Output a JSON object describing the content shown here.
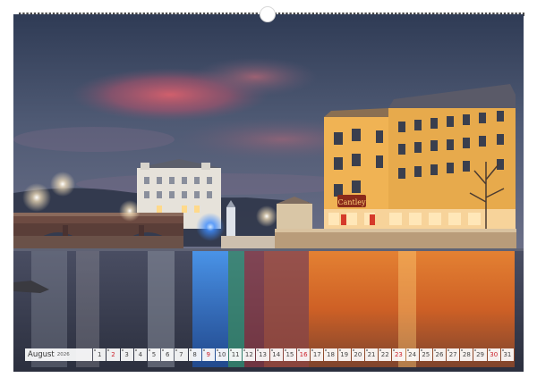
{
  "calendar": {
    "month": "August",
    "year": "2026",
    "days": [
      {
        "n": "1",
        "red": false
      },
      {
        "n": "2",
        "red": true
      },
      {
        "n": "3",
        "red": false
      },
      {
        "n": "4",
        "red": false
      },
      {
        "n": "5",
        "red": false
      },
      {
        "n": "6",
        "red": false
      },
      {
        "n": "7",
        "red": false
      },
      {
        "n": "8",
        "red": false
      },
      {
        "n": "9",
        "red": true
      },
      {
        "n": "10",
        "red": false
      },
      {
        "n": "11",
        "red": false
      },
      {
        "n": "12",
        "red": false
      },
      {
        "n": "13",
        "red": false
      },
      {
        "n": "14",
        "red": false
      },
      {
        "n": "15",
        "red": false
      },
      {
        "n": "16",
        "red": true
      },
      {
        "n": "17",
        "red": false
      },
      {
        "n": "18",
        "red": false
      },
      {
        "n": "19",
        "red": false
      },
      {
        "n": "20",
        "red": false
      },
      {
        "n": "21",
        "red": false
      },
      {
        "n": "22",
        "red": false
      },
      {
        "n": "23",
        "red": true
      },
      {
        "n": "24",
        "red": false
      },
      {
        "n": "25",
        "red": false
      },
      {
        "n": "26",
        "red": false
      },
      {
        "n": "27",
        "red": false
      },
      {
        "n": "28",
        "red": false
      },
      {
        "n": "29",
        "red": false
      },
      {
        "n": "30",
        "red": true
      },
      {
        "n": "31",
        "red": false
      }
    ]
  },
  "photo": {
    "sign_text": "Cantley",
    "colors": {
      "sky_top": "#3b4a66",
      "sky_mid": "#5a6178",
      "cloud": "#c95a6a",
      "building_warm": "#f0b354",
      "water_orange": "#e8661e",
      "water_blue": "#1f6fd6",
      "red_accent": "#cc1f2a"
    }
  }
}
